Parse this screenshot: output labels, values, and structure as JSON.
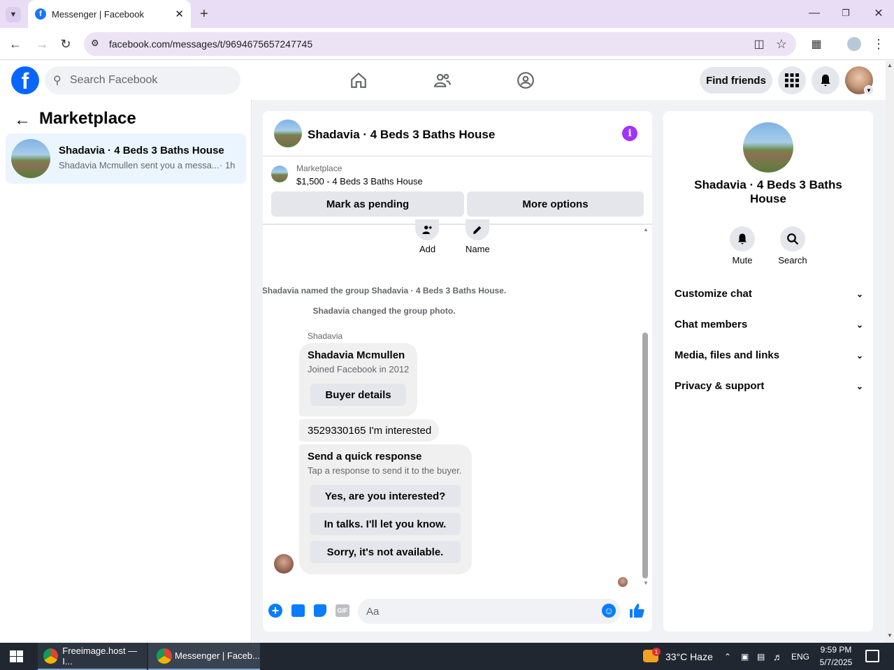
{
  "browser": {
    "tab_title": "Messenger | Facebook",
    "url": "facebook.com/messages/t/9694675657247745"
  },
  "fb_header": {
    "search_placeholder": "Search Facebook",
    "find_friends": "Find friends"
  },
  "sidebar": {
    "title": "Marketplace",
    "conversation": {
      "name": "Shadavia · 4 Beds 3 Baths House",
      "preview": "Shadavia Mcmullen sent you a messa...",
      "time": "· 1h"
    }
  },
  "chat": {
    "header_title": "Shadavia · 4 Beds 3 Baths House",
    "listing": {
      "category": "Marketplace",
      "price_title": "$1,500 - 4 Beds 3 Baths House"
    },
    "mark_pending": "Mark as pending",
    "more_options": "More options",
    "add_label": "Add",
    "name_label": "Name",
    "system_messages": [
      "Shadavia named the group Shadavia · 4 Beds 3 Baths House.",
      "Shadavia changed the group photo."
    ],
    "sender": "Shadavia",
    "profile_card": {
      "name": "Shadavia Mcmullen",
      "joined": "Joined Facebook in 2012",
      "buyer_details": "Buyer details"
    },
    "message": "3529330165 I'm interested",
    "quick_response": {
      "title": "Send a quick response",
      "subtitle": "Tap a response to send it to the buyer.",
      "options": [
        "Yes, are you interested?",
        "In talks. I'll let you know.",
        "Sorry, it's not available."
      ]
    },
    "composer_placeholder": "Aa"
  },
  "right_panel": {
    "title": "Shadavia · 4 Beds 3 Baths House",
    "mute": "Mute",
    "search": "Search",
    "menu": [
      "Customize chat",
      "Chat members",
      "Media, files and links",
      "Privacy & support"
    ]
  },
  "taskbar": {
    "item1": "Freeimage.host — I...",
    "item2": "Messenger | Faceb...",
    "weather": "33°C Haze",
    "lang": "ENG",
    "time": "9:59 PM",
    "date": "5/7/2025",
    "notification_count": "1"
  },
  "colors": {
    "fb_blue": "#0866ff",
    "accent_purple": "#a033ff",
    "messenger_blue": "#0a7cff"
  }
}
